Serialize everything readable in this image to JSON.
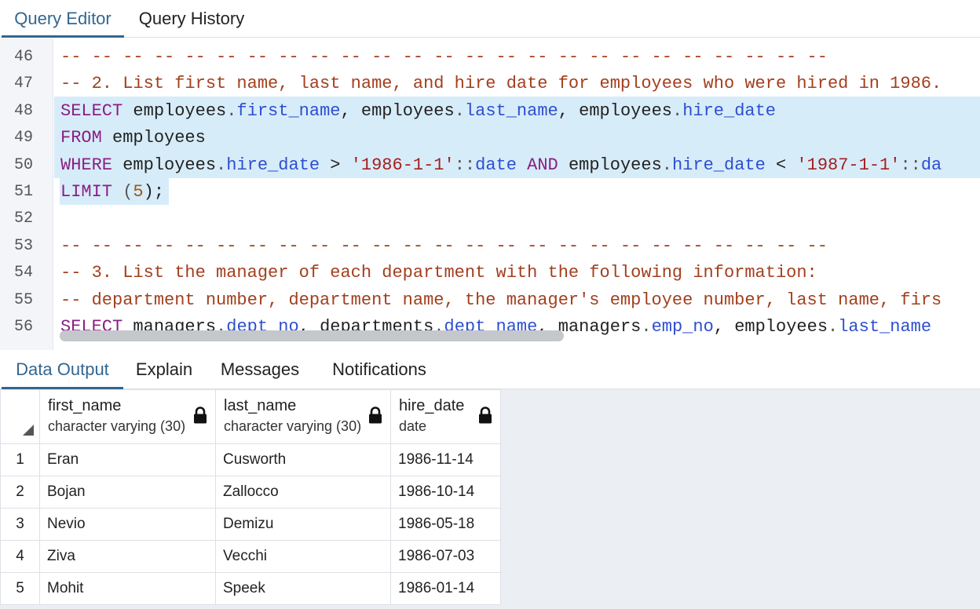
{
  "top_tabs": [
    "Query Editor",
    "Query History"
  ],
  "editor": {
    "lines": [
      {
        "num": "46",
        "tokens": [
          {
            "t": "-- -- -- -- -- -- -- -- -- -- -- -- -- -- -- -- -- -- -- -- -- -- -- -- --",
            "c": "t-comment"
          }
        ]
      },
      {
        "num": "47",
        "tokens": [
          {
            "t": "-- 2. List first name, last name, and hire date for employees who were hired in 1986.",
            "c": "t-comment"
          }
        ]
      },
      {
        "num": "48",
        "tokens": [
          {
            "t": "SELECT",
            "c": "t-kw"
          },
          {
            "t": " employees",
            "c": "t-plain"
          },
          {
            "t": ".",
            "c": "t-op"
          },
          {
            "t": "first_name",
            "c": "t-prop"
          },
          {
            "t": ", employees",
            "c": "t-plain"
          },
          {
            "t": ".",
            "c": "t-op"
          },
          {
            "t": "last_name",
            "c": "t-prop"
          },
          {
            "t": ", employees",
            "c": "t-plain"
          },
          {
            "t": ".",
            "c": "t-op"
          },
          {
            "t": "hire_date",
            "c": "t-prop"
          }
        ]
      },
      {
        "num": "49",
        "tokens": [
          {
            "t": "FROM",
            "c": "t-kw"
          },
          {
            "t": " employees",
            "c": "t-plain"
          }
        ]
      },
      {
        "num": "50",
        "tokens": [
          {
            "t": "WHERE",
            "c": "t-kw"
          },
          {
            "t": " employees",
            "c": "t-plain"
          },
          {
            "t": ".",
            "c": "t-op"
          },
          {
            "t": "hire_date",
            "c": "t-prop"
          },
          {
            "t": " > ",
            "c": "t-plain"
          },
          {
            "t": "'1986-1-1'",
            "c": "t-str"
          },
          {
            "t": "::",
            "c": "t-op"
          },
          {
            "t": "date",
            "c": "t-prop"
          },
          {
            "t": " ",
            "c": "t-plain"
          },
          {
            "t": "AND",
            "c": "t-kw"
          },
          {
            "t": " employees",
            "c": "t-plain"
          },
          {
            "t": ".",
            "c": "t-op"
          },
          {
            "t": "hire_date",
            "c": "t-prop"
          },
          {
            "t": " < ",
            "c": "t-plain"
          },
          {
            "t": "'1987-1-1'",
            "c": "t-str"
          },
          {
            "t": "::",
            "c": "t-op"
          },
          {
            "t": "da",
            "c": "t-prop"
          }
        ]
      },
      {
        "num": "51",
        "tokens": [
          {
            "t": "LIMIT",
            "c": "t-kw"
          },
          {
            "t": " (",
            "c": "t-op"
          },
          {
            "t": "5",
            "c": "t-num"
          },
          {
            "t": ");",
            "c": "t-plain"
          }
        ]
      },
      {
        "num": "52",
        "tokens": []
      },
      {
        "num": "53",
        "tokens": [
          {
            "t": "-- -- -- -- -- -- -- -- -- -- -- -- -- -- -- -- -- -- -- -- -- -- -- -- --",
            "c": "t-comment"
          }
        ]
      },
      {
        "num": "54",
        "tokens": [
          {
            "t": "-- 3. List the manager of each department with the following information:",
            "c": "t-comment"
          }
        ]
      },
      {
        "num": "55",
        "tokens": [
          {
            "t": "-- department number, department name, the manager's employee number, last name, firs",
            "c": "t-comment"
          }
        ]
      },
      {
        "num": "56",
        "tokens": [
          {
            "t": "SELECT",
            "c": "t-kw"
          },
          {
            "t": " managers",
            "c": "t-plain"
          },
          {
            "t": ".",
            "c": "t-op"
          },
          {
            "t": "dept_no",
            "c": "t-prop"
          },
          {
            "t": ", departments",
            "c": "t-plain"
          },
          {
            "t": ".",
            "c": "t-op"
          },
          {
            "t": "dept_name",
            "c": "t-prop"
          },
          {
            "t": ", managers",
            "c": "t-plain"
          },
          {
            "t": ".",
            "c": "t-op"
          },
          {
            "t": "emp_no",
            "c": "t-prop"
          },
          {
            "t": ", employees",
            "c": "t-plain"
          },
          {
            "t": ".",
            "c": "t-op"
          },
          {
            "t": "last_name",
            "c": "t-prop"
          }
        ]
      }
    ]
  },
  "bottom_tabs": [
    "Data Output",
    "Explain",
    "Messages",
    "Notifications"
  ],
  "grid": {
    "columns": [
      {
        "name": "first_name",
        "type": "character varying (30)"
      },
      {
        "name": "last_name",
        "type": "character varying (30)"
      },
      {
        "name": "hire_date",
        "type": "date"
      }
    ],
    "rows": [
      {
        "n": "1",
        "cells": [
          "Eran",
          "Cusworth",
          "1986-11-14"
        ]
      },
      {
        "n": "2",
        "cells": [
          "Bojan",
          "Zallocco",
          "1986-10-14"
        ]
      },
      {
        "n": "3",
        "cells": [
          "Nevio",
          "Demizu",
          "1986-05-18"
        ]
      },
      {
        "n": "4",
        "cells": [
          "Ziva",
          "Vecchi",
          "1986-07-03"
        ]
      },
      {
        "n": "5",
        "cells": [
          "Mohit",
          "Speek",
          "1986-01-14"
        ]
      }
    ]
  },
  "colors": {
    "accent": "#326690",
    "selection": "#d7ecf9"
  }
}
